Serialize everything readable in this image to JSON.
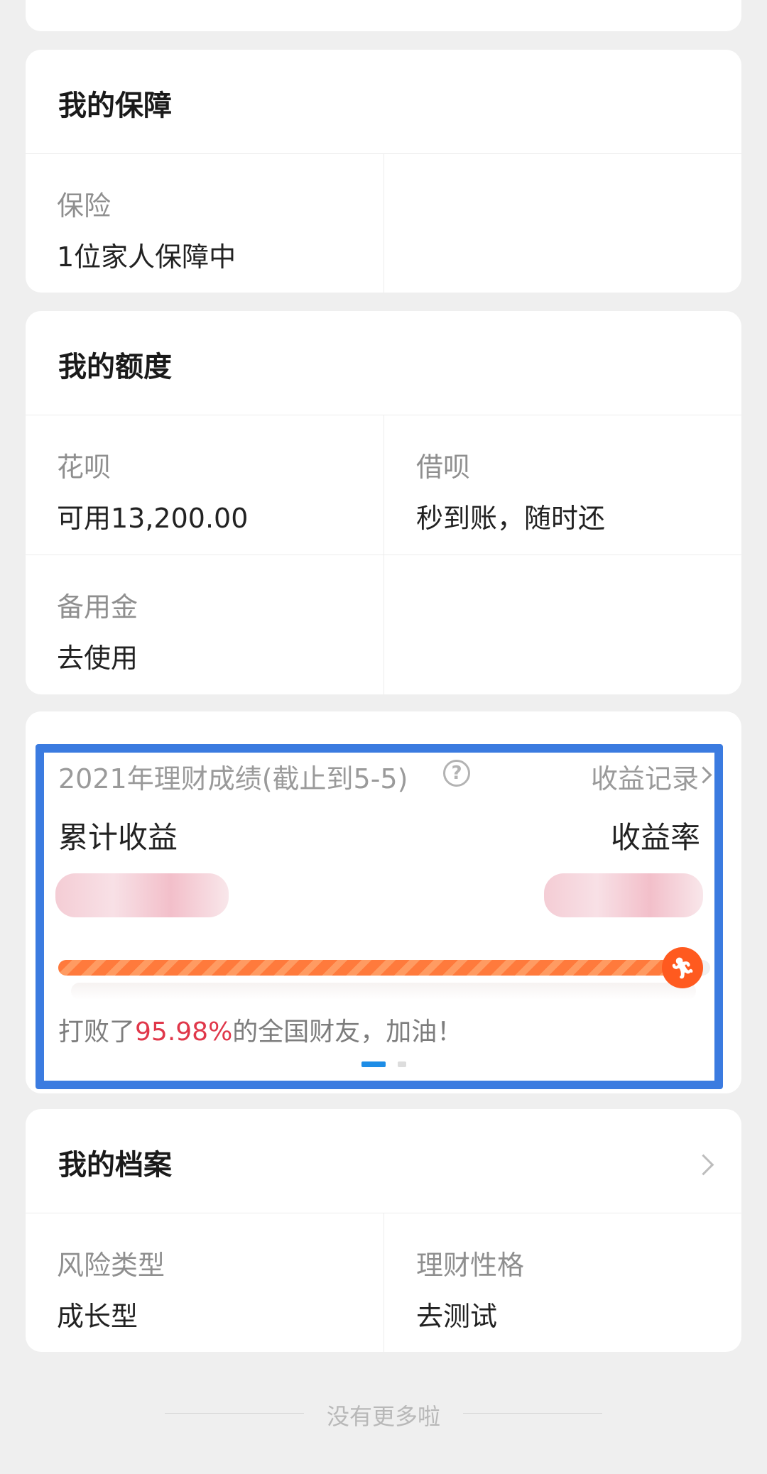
{
  "protection": {
    "title": "我的保障",
    "insurance_label": "保险",
    "insurance_value": "1位家人保障中"
  },
  "credit": {
    "title": "我的额度",
    "huabei_label": "花呗",
    "huabei_value": "可用13,200.00",
    "jiebei_label": "借呗",
    "jiebei_value": "秒到账，随时还",
    "reserve_label": "备用金",
    "reserve_value": "去使用"
  },
  "wealth": {
    "title": "2021年理财成绩(截止到5-5)",
    "help_icon": "question-circle-icon",
    "records_link": "收益记录",
    "cumulative_label": "累计收益",
    "rate_label": "收益率",
    "progress_fraction": 0.97,
    "beat_prefix": "打败了",
    "beat_percent": "95.98%",
    "beat_suffix": "的全国财友，加油！",
    "accent_color": "#e0374a",
    "bar_color": "#ff5a1f",
    "highlight_color": "#3b7be0"
  },
  "archive": {
    "title": "我的档案",
    "risk_label": "风险类型",
    "risk_value": "成长型",
    "personality_label": "理财性格",
    "personality_value": "去测试"
  },
  "footer": {
    "text": "没有更多啦"
  }
}
